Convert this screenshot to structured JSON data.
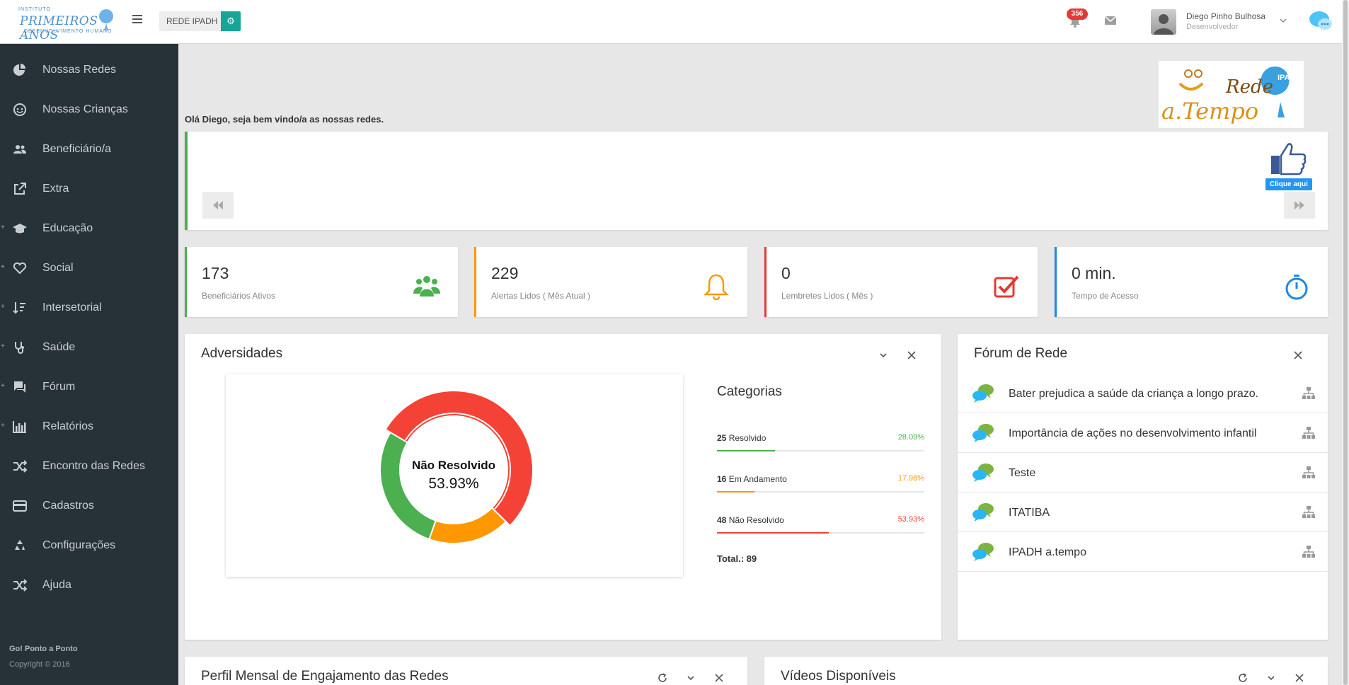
{
  "header": {
    "logo_top": "INSTITUTO",
    "logo_main": "PRIMEIROS ANOS",
    "logo_bottom": "DESENVOLVIMENTO HUMANO",
    "rede_label": "REDE IPADH",
    "notification_count": "356",
    "user_name": "Diego Pinho Bulhosa",
    "user_role": "Desenvolvedor"
  },
  "sidebar": {
    "items": [
      {
        "label": "Nossas Redes",
        "icon": "pie-chart-icon",
        "expandable": false
      },
      {
        "label": "Nossas Crianças",
        "icon": "child-face-icon",
        "expandable": false
      },
      {
        "label": "Beneficiário/a",
        "icon": "people-icon",
        "expandable": false
      },
      {
        "label": "Extra",
        "icon": "external-link-icon",
        "expandable": false
      },
      {
        "label": "Educação",
        "icon": "graduation-cap-icon",
        "expandable": true
      },
      {
        "label": "Social",
        "icon": "heart-icon",
        "expandable": true
      },
      {
        "label": "Intersetorial",
        "icon": "sort-icon",
        "expandable": true
      },
      {
        "label": "Saúde",
        "icon": "stethoscope-icon",
        "expandable": true
      },
      {
        "label": "Fórum",
        "icon": "forum-icon",
        "expandable": true
      },
      {
        "label": "Relatórios",
        "icon": "bar-chart-icon",
        "expandable": true
      },
      {
        "label": "Encontro das Redes",
        "icon": "shuffle-icon",
        "expandable": false
      },
      {
        "label": "Cadastros",
        "icon": "credit-card-icon",
        "expandable": false
      },
      {
        "label": "Configurações",
        "icon": "recycle-icon",
        "expandable": false
      },
      {
        "label": "Ajuda",
        "icon": "shuffle-icon",
        "expandable": false
      }
    ],
    "footer_title": "Go! Ponto a Ponto",
    "footer_copyright": "Copyright © 2016"
  },
  "main": {
    "welcome": "Olá Diego, seja bem vindo/a as nossas redes.",
    "brand_logo": {
      "top": "Rede",
      "bottom": "a.Tempo",
      "badge": "IPA DH"
    },
    "banner": {
      "cta_label": "Clique aqui"
    }
  },
  "stats": [
    {
      "value": "173",
      "caption": "Beneficiários Ativos",
      "color": "#4caf50",
      "icon": "users-icon"
    },
    {
      "value": "229",
      "caption": "Alertas Lidos ( Mês Atual )",
      "color": "#ff9800",
      "icon": "bell-icon"
    },
    {
      "value": "0",
      "caption": "Lembretes Lidos ( Mês )",
      "color": "#e53935",
      "icon": "checkbox-icon"
    },
    {
      "value": "0 min.",
      "caption": "Tempo de Acesso",
      "color": "#1e88e5",
      "icon": "stopwatch-icon"
    }
  ],
  "adversidades": {
    "title": "Adversidades",
    "donut_label": "Não Resolvido",
    "donut_pct": "53.93%",
    "categories_title": "Categorias",
    "total": "Total.: 89"
  },
  "chart_data": {
    "type": "pie",
    "title": "Adversidades",
    "categories": [
      "Resolvido",
      "Em Andamento",
      "Não Resolvido"
    ],
    "values": [
      25,
      16,
      48
    ],
    "percent_labels": [
      "28.09%",
      "17.98%",
      "53.93%"
    ],
    "colors": [
      "#4caf50",
      "#ff9800",
      "#f44336"
    ],
    "donut": true,
    "highlighted": "Não Resolvido",
    "total": 89
  },
  "forum": {
    "title": "Fórum de Rede",
    "items": [
      "Bater prejudica a saúde da criança a longo prazo.",
      "Importância de ações no desenvolvimento infantil",
      "Teste",
      "ITATIBA",
      "IPADH a.tempo"
    ]
  },
  "bottom_panels": {
    "engagement_title": "Perfil Mensal de Engajamento das Redes",
    "videos_title": "Vídeos Disponíveis"
  }
}
